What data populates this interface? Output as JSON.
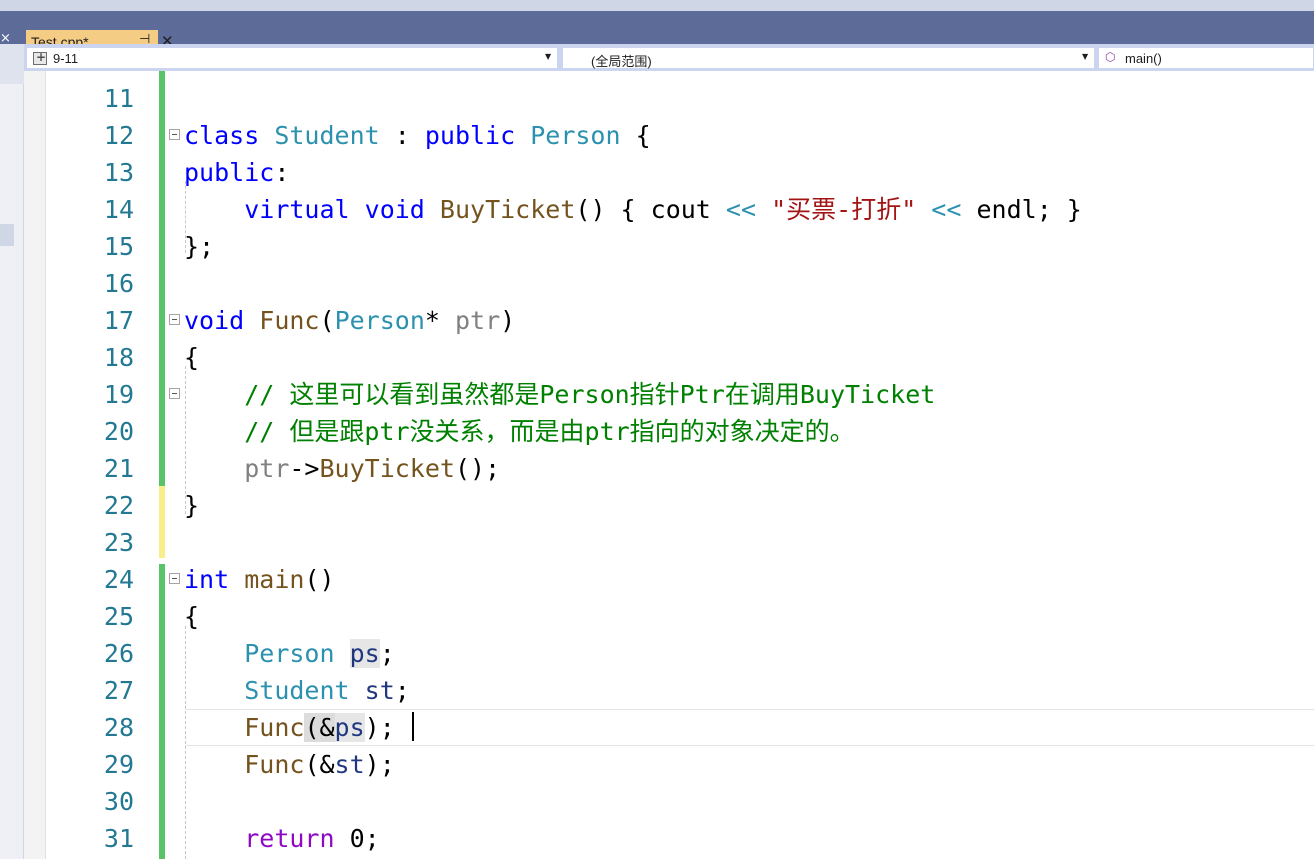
{
  "tab": {
    "filename": "Test.cpp*",
    "pin_glyph": "⊣",
    "close_glyph": "✕"
  },
  "nav": {
    "project": "9-11",
    "scope": "(全局范围)",
    "member": "main()"
  },
  "editor": {
    "lines": [
      {
        "number": "11"
      },
      {
        "number": "12"
      },
      {
        "number": "13"
      },
      {
        "number": "14"
      },
      {
        "number": "15"
      },
      {
        "number": "16"
      },
      {
        "number": "17"
      },
      {
        "number": "18"
      },
      {
        "number": "19"
      },
      {
        "number": "20"
      },
      {
        "number": "21"
      },
      {
        "number": "22"
      },
      {
        "number": "23"
      },
      {
        "number": "24"
      },
      {
        "number": "25"
      },
      {
        "number": "26"
      },
      {
        "number": "27"
      },
      {
        "number": "28"
      },
      {
        "number": "29"
      },
      {
        "number": "30"
      },
      {
        "number": "31"
      }
    ],
    "tokens": {
      "l12_class": "class",
      "l12_student": "Student",
      "l12_colon": " : ",
      "l12_public": "public",
      "l12_person": "Person",
      "l12_brace": " {",
      "l13_public": "public",
      "l13_colon": ":",
      "l14_virtual": "virtual",
      "l14_void": "void",
      "l14_fn": "BuyTicket",
      "l14_mid": "() { ",
      "l14_cout": "cout",
      "l14_op1": " << ",
      "l14_str": "\"买票-打折\"",
      "l14_op2": " << ",
      "l14_endl": "endl",
      "l14_end": "; }",
      "l15": "};",
      "l17_void": "void",
      "l17_fn": "Func",
      "l17_paren": "(",
      "l17_person": "Person",
      "l17_star": "* ",
      "l17_ptr": "ptr",
      "l17_close": ")",
      "l18": "{",
      "l19_comment": "// 这里可以看到虽然都是Person指针Ptr在调用BuyTicket",
      "l20_comment": "// 但是跟ptr没关系，而是由ptr指向的对象决定的。",
      "l21_ptr": "ptr",
      "l21_arrow": "->",
      "l21_fn": "BuyTicket",
      "l21_end": "();",
      "l22": "}",
      "l24_int": "int",
      "l24_fn": "main",
      "l24_end": "()",
      "l25": "{",
      "l26_type": "Person",
      "l26_var": "ps",
      "l26_end": ";",
      "l27_type": "Student",
      "l27_var": "st",
      "l27_end": ";",
      "l28_fn": "Func",
      "l28_open": "(&",
      "l28_var": "ps",
      "l28_close": ");",
      "l29_fn": "Func",
      "l29_open": "(&",
      "l29_var": "st",
      "l29_close": ");",
      "l31_return": "return",
      "l31_end": " 0;"
    }
  }
}
